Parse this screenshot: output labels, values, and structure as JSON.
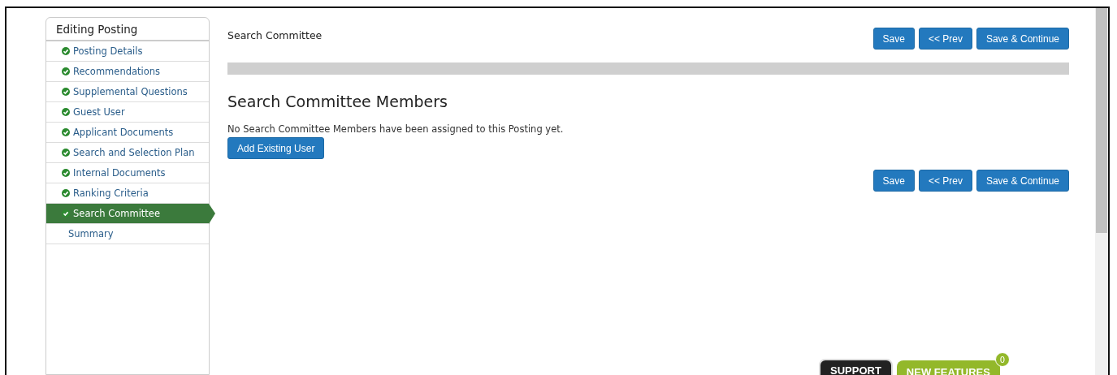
{
  "sidebar": {
    "title": "Editing Posting",
    "items": [
      {
        "label": "Posting Details",
        "done": true,
        "selected": false
      },
      {
        "label": "Recommendations",
        "done": true,
        "selected": false
      },
      {
        "label": "Supplemental Questions",
        "done": true,
        "selected": false
      },
      {
        "label": "Guest User",
        "done": true,
        "selected": false
      },
      {
        "label": "Applicant Documents",
        "done": true,
        "selected": false
      },
      {
        "label": "Search and Selection Plan",
        "done": true,
        "selected": false
      },
      {
        "label": "Internal Documents",
        "done": true,
        "selected": false
      },
      {
        "label": "Ranking Criteria",
        "done": true,
        "selected": false
      },
      {
        "label": "Search Committee",
        "done": true,
        "selected": true
      },
      {
        "label": "Summary",
        "done": false,
        "selected": false
      }
    ]
  },
  "page_title": "Search Committee",
  "top_buttons": [
    "Save",
    "<< Prev",
    "Save & Continue"
  ],
  "section": {
    "heading": "Search Committee Members",
    "message": "No Search Committee Members have been assigned to this Posting yet.",
    "button": "Add Existing User"
  },
  "bottom_buttons": [
    "Save",
    "<< Prev",
    "Save & Continue"
  ],
  "footer": {
    "support": "SUPPORT",
    "new_features": "NEW FEATURES",
    "count": "0"
  }
}
